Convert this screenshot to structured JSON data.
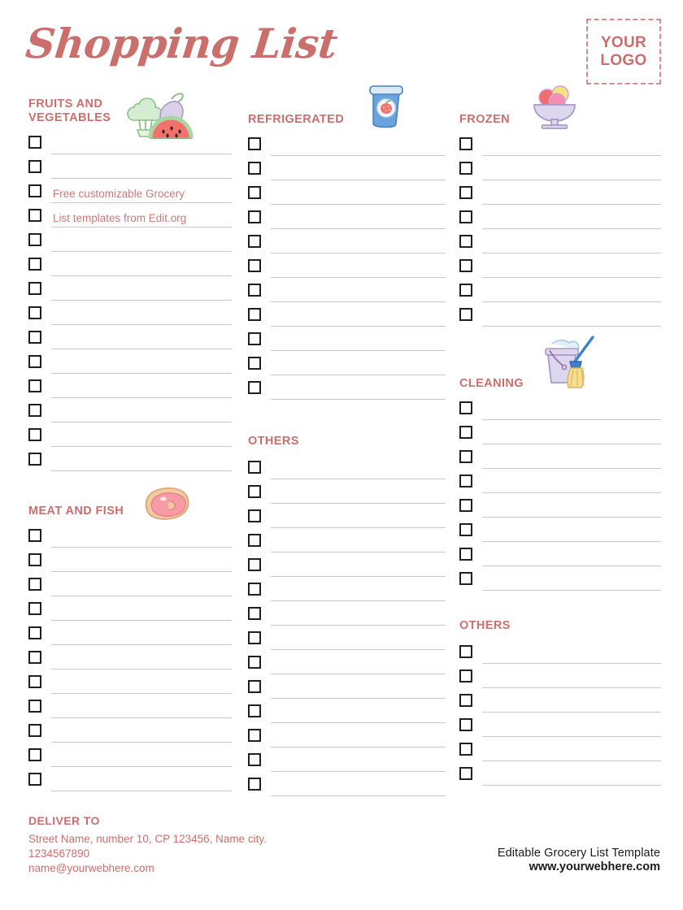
{
  "header": {
    "title": "Shopping List",
    "logo_line1": "YOUR",
    "logo_line2": "LOGO"
  },
  "colors": {
    "accent": "#cb6f6d",
    "rule": "#c9c9c9",
    "checkbox_border": "#231f20",
    "promo_text": "#cb7b77",
    "brand_text": "#1b1b1b"
  },
  "sections": {
    "fruits": {
      "title": "FRUITS AND\nVEGETABLES",
      "icon": "broccoli-eggplant-watermelon-icon",
      "row_count": 14,
      "rows": [
        "",
        "",
        "Free customizable Grocery",
        "List templates from Edit.org",
        "",
        "",
        "",
        "",
        "",
        "",
        "",
        "",
        "",
        ""
      ]
    },
    "meat": {
      "title": "MEAT AND FISH",
      "icon": "steak-icon",
      "row_count": 11,
      "rows": [
        "",
        "",
        "",
        "",
        "",
        "",
        "",
        "",
        "",
        "",
        ""
      ]
    },
    "refrigerated": {
      "title": "REFRIGERATED",
      "icon": "yogurt-cup-icon",
      "row_count": 11,
      "rows": [
        "",
        "",
        "",
        "",
        "",
        "",
        "",
        "",
        "",
        "",
        ""
      ]
    },
    "others_middle": {
      "title": "OTHERS",
      "icon": null,
      "row_count": 14,
      "rows": [
        "",
        "",
        "",
        "",
        "",
        "",
        "",
        "",
        "",
        "",
        "",
        "",
        "",
        ""
      ]
    },
    "frozen": {
      "title": "FROZEN",
      "icon": "ice-cream-bowl-icon",
      "row_count": 8,
      "rows": [
        "",
        "",
        "",
        "",
        "",
        "",
        "",
        ""
      ]
    },
    "cleaning": {
      "title": "CLEANING",
      "icon": "bucket-broom-icon",
      "row_count": 8,
      "rows": [
        "",
        "",
        "",
        "",
        "",
        "",
        "",
        ""
      ]
    },
    "others_right": {
      "title": "OTHERS",
      "icon": null,
      "row_count": 6,
      "rows": [
        "",
        "",
        "",
        "",
        "",
        ""
      ]
    }
  },
  "footer": {
    "deliver_title": "DELIVER TO",
    "address_line1": "Street Name, number 10, CP 123456, Name city.",
    "address_line2": "1234567890",
    "address_line3": "name@yourwebhere.com",
    "brand_line1": "Editable Grocery List Template",
    "brand_line2": "www.yourwebhere.com"
  }
}
